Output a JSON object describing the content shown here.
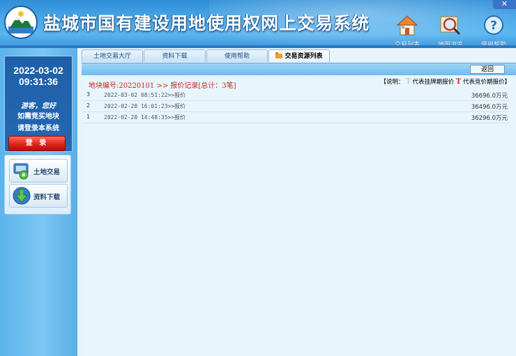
{
  "header": {
    "title": "盐城市国有建设用地使用权网上交易系统",
    "close_label": "✕",
    "nav": [
      {
        "label": "交易列表",
        "icon": "house-icon"
      },
      {
        "label": "地图浏览",
        "icon": "map-magnifier-icon"
      },
      {
        "label": "使用帮助",
        "icon": "help-icon"
      }
    ]
  },
  "sidebar": {
    "date": "2022-03-02",
    "time": "09:31:36",
    "welcome": "游客，您好",
    "hint1": "如需竞买地块",
    "hint2": "请登录本系统",
    "login_label": "登 录",
    "menu": [
      {
        "label": "土地交易",
        "icon": "land-trade-icon"
      },
      {
        "label": "资料下载",
        "icon": "download-icon"
      }
    ]
  },
  "tabs": [
    {
      "label": "土地交易大厅",
      "active": false
    },
    {
      "label": "资料下载",
      "active": false
    },
    {
      "label": "使用帮助",
      "active": false
    },
    {
      "label": "交易资源列表",
      "active": true
    }
  ],
  "toolbar": {
    "back_label": "返回"
  },
  "record": {
    "title": "地块编号:20220101 >> 报价记录[总计：3笔]",
    "legend_prefix": "【说明：",
    "legend_t1": "T",
    "legend_t1_text": "代表挂牌期报价",
    "legend_t2": "T",
    "legend_t2_text": "代表竞价期报价】",
    "rows": [
      {
        "seq": "3",
        "time": "2022-03-02 08:51:22>>报价",
        "value": "36696.0万元"
      },
      {
        "seq": "2",
        "time": "2022-02-28 16:01:23>>报价",
        "value": "36496.0万元"
      },
      {
        "seq": "1",
        "time": "2022-02-28 14:48:35>>报价",
        "value": "36296.0万元"
      }
    ]
  },
  "colors": {
    "header_blue": "#4aa8ea",
    "accent_red": "#c8261a",
    "login_red": "#e2231a"
  }
}
